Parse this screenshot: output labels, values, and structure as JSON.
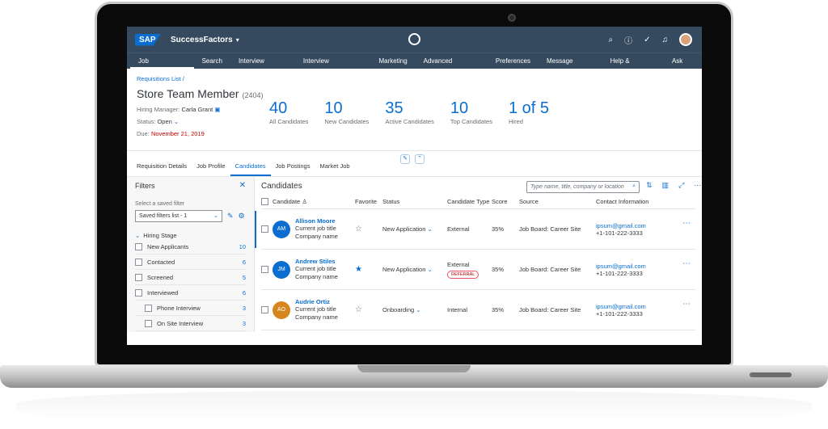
{
  "shell": {
    "logo": "SAP",
    "product": "SuccessFactors",
    "icons": [
      "search-icon",
      "help-icon",
      "approvals-icon",
      "bell-icon",
      "avatar"
    ]
  },
  "nav": [
    "Job Requisitions",
    "Search",
    "Interview Central",
    "Interview Scheduling",
    "Marketing",
    "Advanced Analytics",
    "Preferences",
    "Message Center",
    "Help & Tutorials",
    "Ask HR"
  ],
  "header": {
    "breadcrumb": "Requisitions List /",
    "title": "Store Team Member",
    "id": "(2404)",
    "hiring_manager_label": "Hiring Manager:",
    "hiring_manager": "Carla Grant",
    "status_label": "Status:",
    "status": "Open",
    "due_label": "Due:",
    "due": "November 21, 2019",
    "kpis": [
      {
        "value": "40",
        "label": "All Candidates"
      },
      {
        "value": "10",
        "label": "New Candidates"
      },
      {
        "value": "35",
        "label": "Active Candidates"
      },
      {
        "value": "10",
        "label": "Top Candidates"
      },
      {
        "value": "1 of 5",
        "label": "Hired"
      }
    ]
  },
  "tabs": [
    "Requisition Details",
    "Job Profile",
    "Candidates",
    "Job Postings",
    "Market Job"
  ],
  "filters": {
    "title": "Filters",
    "saved_label": "Select a saved filter",
    "saved_value": "Saved filters list - 1",
    "stage_header": "Hiring Stage",
    "items": [
      {
        "label": "New Applicants",
        "count": "10"
      },
      {
        "label": "Contacted",
        "count": "6"
      },
      {
        "label": "Screened",
        "count": "5"
      },
      {
        "label": "Interviewed",
        "count": "6"
      },
      {
        "label": "Phone Interview",
        "count": "3"
      },
      {
        "label": "On Site Interview",
        "count": "3"
      }
    ]
  },
  "list": {
    "title": "Candidates",
    "search_placeholder": "Type name, title, company or location",
    "columns": [
      "Candidate",
      "Favorite",
      "Status",
      "Candidate Type",
      "Score",
      "Source",
      "Contact Information"
    ],
    "rows": [
      {
        "initials": "AM",
        "color": "#0a6ed1",
        "name": "Allison Moore",
        "title": "Current job title",
        "company": "Company name",
        "favorite": false,
        "status": "New Application",
        "type": "External",
        "badge": "",
        "score": "35%",
        "source": "Job Board: Career Site",
        "email": "ipsum@gmail.com",
        "phone": "+1-101-222-3333"
      },
      {
        "initials": "JM",
        "color": "#0a6ed1",
        "name": "Andrew Stiles",
        "title": "Current job title",
        "company": "Company name",
        "favorite": true,
        "status": "New Application",
        "type": "External",
        "badge": "REFERRAL",
        "score": "35%",
        "source": "Job Board: Career Site",
        "email": "ipsum@gmail.com",
        "phone": "+1-101-222-3333"
      },
      {
        "initials": "AO",
        "color": "#d6861c",
        "name": "Audrie Ortiz",
        "title": "Current job title",
        "company": "Company name",
        "favorite": false,
        "status": "Onboarding",
        "type": "Internal",
        "badge": "",
        "score": "35%",
        "source": "Job Board: Career Site",
        "email": "ipsum@gmail.com",
        "phone": "+1-101-222-3333"
      }
    ]
  }
}
